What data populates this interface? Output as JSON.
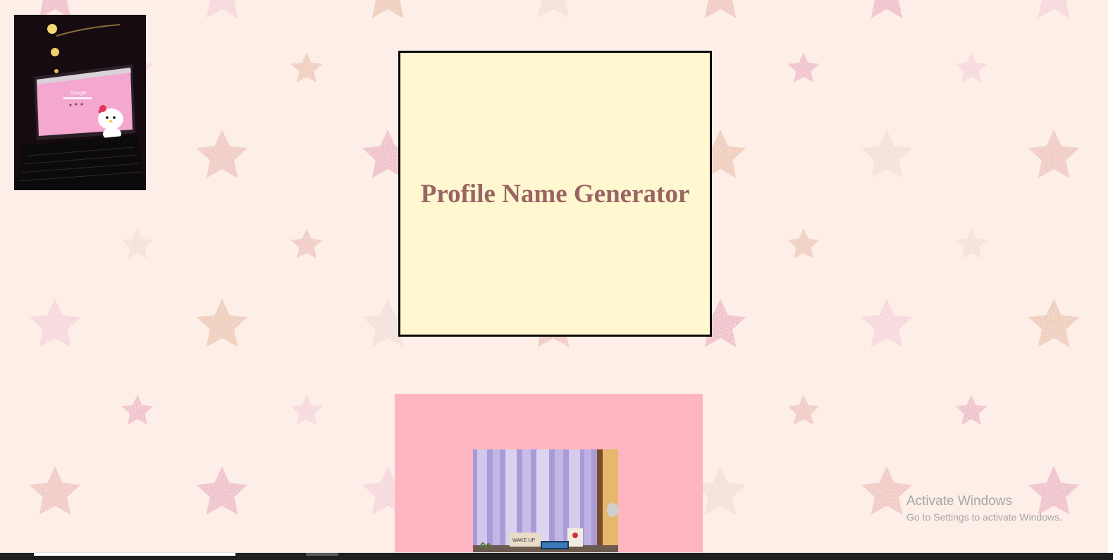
{
  "title": {
    "text": "Profile Name Generator",
    "color": "#9a6464",
    "background": "#fff7d0"
  },
  "background": {
    "base_color": "#fdeee8",
    "pattern": "glitter-stars",
    "star_colors": [
      "#e9a3b4",
      "#f2c7cf",
      "#e7b79b",
      "#ecd6cb",
      "#eab2a8"
    ]
  },
  "images": {
    "laptop": {
      "subject": "laptop-with-pink-hello-kitty-wallpaper",
      "screen_text": "Google"
    },
    "desk": {
      "subject": "desk-by-window-with-curtains",
      "sign_text": "WAKE UP"
    }
  },
  "panel": {
    "color": "#ffb5c1"
  },
  "watermark": {
    "title": "Activate Windows",
    "subtitle": "Go to Settings to activate Windows."
  }
}
